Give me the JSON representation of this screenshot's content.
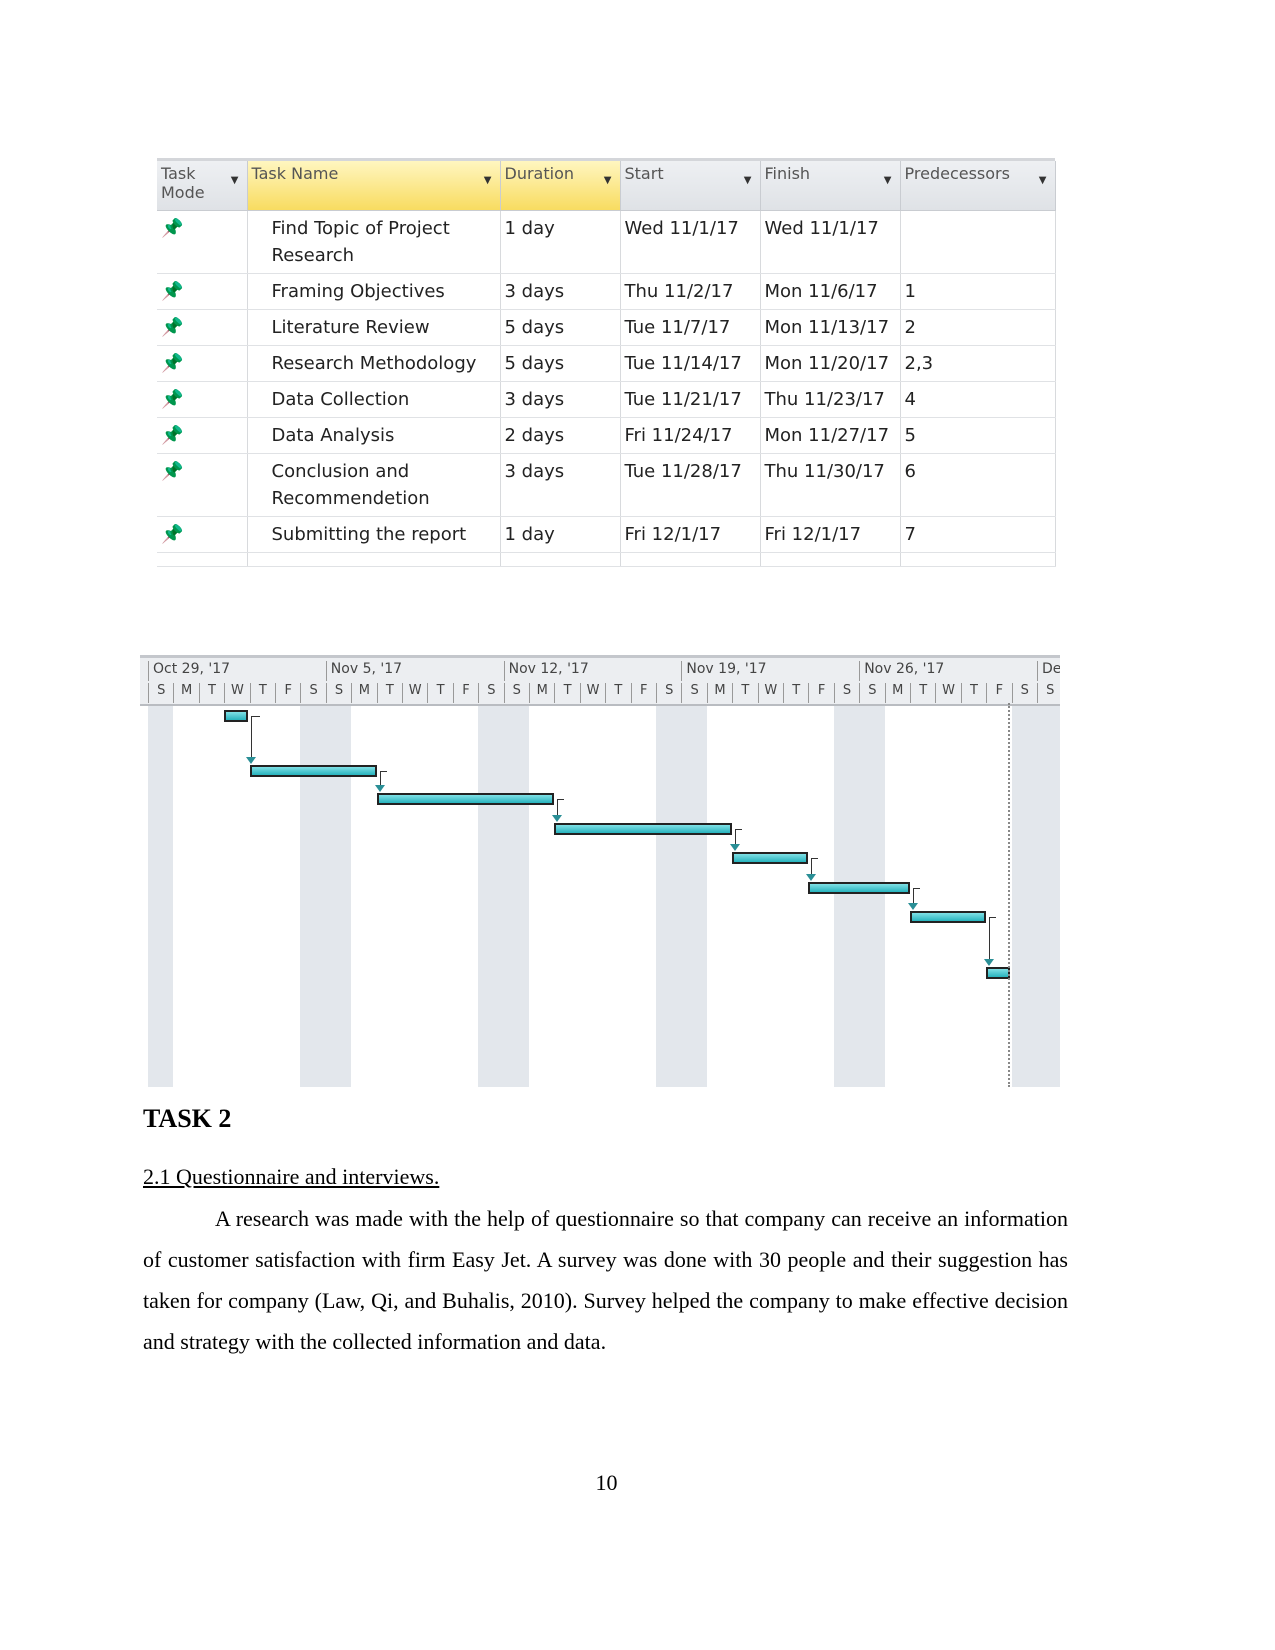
{
  "table": {
    "headers": [
      "Task Mode",
      "Task Name",
      "Duration",
      "Start",
      "Finish",
      "Predecessors"
    ],
    "rows": [
      {
        "name": "Find Topic of Project Research",
        "duration": "1 day",
        "start": "Wed 11/1/17",
        "finish": "Wed 11/1/17",
        "pred": ""
      },
      {
        "name": "Framing Objectives",
        "duration": "3 days",
        "start": "Thu 11/2/17",
        "finish": "Mon 11/6/17",
        "pred": "1"
      },
      {
        "name": "Literature Review",
        "duration": "5 days",
        "start": "Tue 11/7/17",
        "finish": "Mon 11/13/17",
        "pred": "2"
      },
      {
        "name": "Research Methodology",
        "duration": "5 days",
        "start": "Tue 11/14/17",
        "finish": "Mon 11/20/17",
        "pred": "2,3"
      },
      {
        "name": "Data Collection",
        "duration": "3 days",
        "start": "Tue 11/21/17",
        "finish": "Thu 11/23/17",
        "pred": "4"
      },
      {
        "name": "Data Analysis",
        "duration": "2 days",
        "start": "Fri 11/24/17",
        "finish": "Mon 11/27/17",
        "pred": "5"
      },
      {
        "name": "Conclusion and Recommendetion",
        "duration": "3 days",
        "start": "Tue 11/28/17",
        "finish": "Thu 11/30/17",
        "pred": "6"
      },
      {
        "name": "Submitting the report",
        "duration": "1 day",
        "start": "Fri 12/1/17",
        "finish": "Fri 12/1/17",
        "pred": "7"
      }
    ],
    "mode_icon": "pushpin-icon"
  },
  "gantt": {
    "weeks": [
      "Oct 29, '17",
      "Nov 5, '17",
      "Nov 12, '17",
      "Nov 19, '17",
      "Nov 26, '17",
      "Dec"
    ],
    "day_letters": [
      "S",
      "M",
      "T",
      "W",
      "T",
      "F",
      "S"
    ],
    "bar_color": "#27b3bd",
    "tasks": [
      {
        "start": "2017-11-01",
        "finish": "2017-11-01"
      },
      {
        "start": "2017-11-02",
        "finish": "2017-11-06"
      },
      {
        "start": "2017-11-07",
        "finish": "2017-11-13"
      },
      {
        "start": "2017-11-14",
        "finish": "2017-11-20"
      },
      {
        "start": "2017-11-21",
        "finish": "2017-11-23"
      },
      {
        "start": "2017-11-24",
        "finish": "2017-11-27"
      },
      {
        "start": "2017-11-28",
        "finish": "2017-11-30"
      },
      {
        "start": "2017-12-01",
        "finish": "2017-12-01"
      }
    ]
  },
  "doc": {
    "heading": "TASK 2",
    "subheading": "2.1 Questionnaire and interviews.",
    "paragraph": "A research was made with the help of questionnaire so that company can receive an information of customer satisfaction with firm Easy Jet. A survey was done with 30 people and their suggestion has taken for company (Law, Qi, and Buhalis, 2010). Survey helped the company to make effective decision and strategy with the collected information and data.",
    "page_number": "10"
  }
}
